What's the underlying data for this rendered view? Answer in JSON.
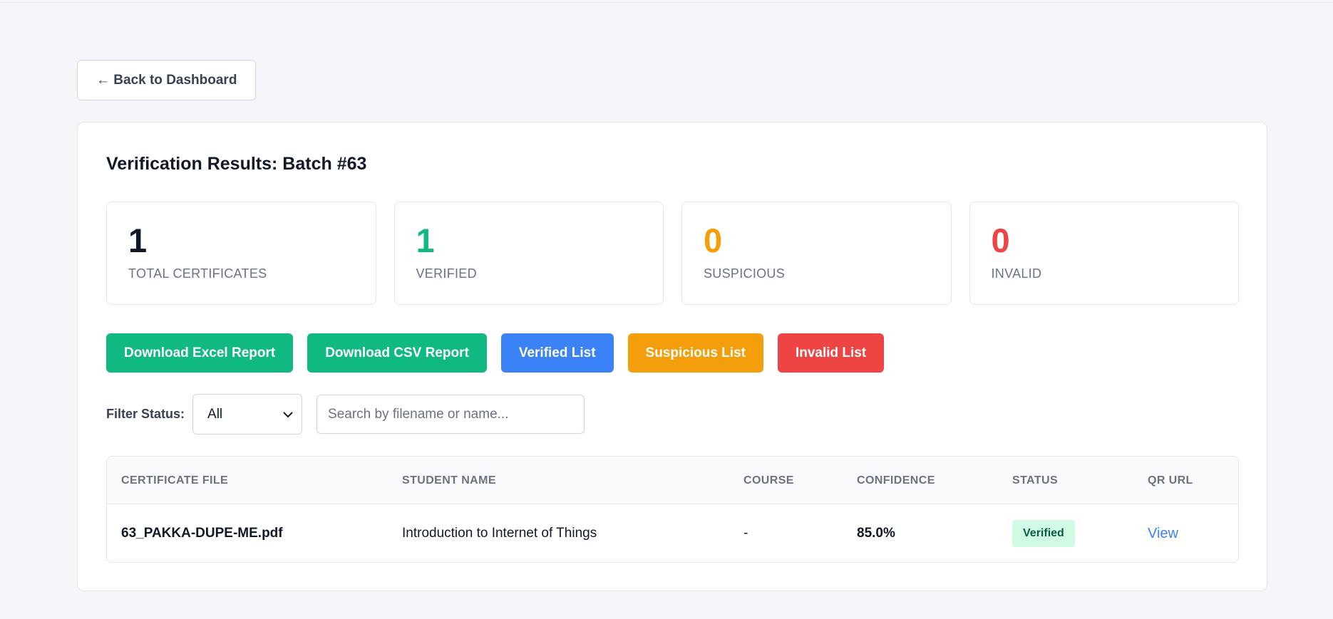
{
  "nav": {
    "back_label": "← Back to Dashboard"
  },
  "page": {
    "title": "Verification Results: Batch #63"
  },
  "stats": [
    {
      "value": "1",
      "label": "TOTAL CERTIFICATES",
      "color": "#111827"
    },
    {
      "value": "1",
      "label": "VERIFIED",
      "color": "#10b981"
    },
    {
      "value": "0",
      "label": "SUSPICIOUS",
      "color": "#f59e0b"
    },
    {
      "value": "0",
      "label": "INVALID",
      "color": "#ef4444"
    }
  ],
  "actions": [
    {
      "label": "Download Excel Report",
      "color": "#10b981"
    },
    {
      "label": "Download CSV Report",
      "color": "#10b981"
    },
    {
      "label": "Verified List",
      "color": "#3b82f6"
    },
    {
      "label": "Suspicious List",
      "color": "#f59e0b"
    },
    {
      "label": "Invalid List",
      "color": "#ef4444"
    }
  ],
  "filters": {
    "status_label": "Filter Status:",
    "status_value": "All",
    "search_placeholder": "Search by filename or name..."
  },
  "table": {
    "headers": [
      "CERTIFICATE FILE",
      "STUDENT NAME",
      "COURSE",
      "CONFIDENCE",
      "STATUS",
      "QR URL"
    ],
    "rows": [
      {
        "file": "63_PAKKA-DUPE-ME.pdf",
        "student": "Introduction to Internet of Things",
        "course": "-",
        "confidence": "85.0%",
        "status": "Verified",
        "qr": "View"
      }
    ]
  }
}
